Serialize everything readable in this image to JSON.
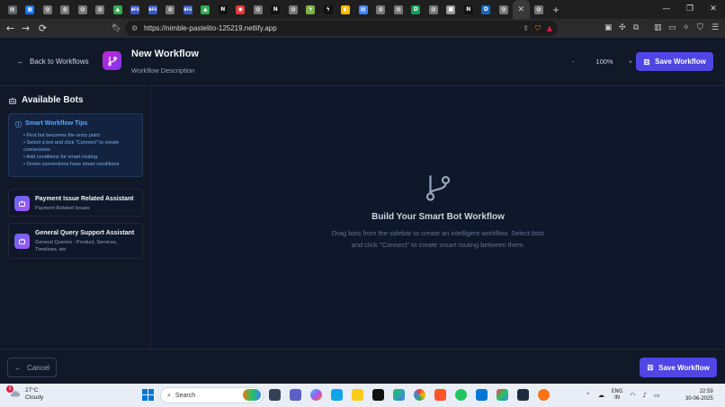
{
  "browser": {
    "tabs": [
      {
        "icon": "doc-icon",
        "color": "#5f6368",
        "glyph": "▤"
      },
      {
        "icon": "app-icon",
        "color": "#1a73e8",
        "glyph": "▦"
      },
      {
        "icon": "globe-icon",
        "color": "#777",
        "glyph": "◍"
      },
      {
        "icon": "globe-icon",
        "color": "#777",
        "glyph": "◍"
      },
      {
        "icon": "globe-icon",
        "color": "#777",
        "glyph": "◍"
      },
      {
        "icon": "globe-icon",
        "color": "#777",
        "glyph": "◍"
      },
      {
        "icon": "drive-icon",
        "color": "#34a853",
        "glyph": "▲"
      },
      {
        "icon": "text-icon",
        "color": "#3a57c4",
        "glyph": "BFS"
      },
      {
        "icon": "text-icon",
        "color": "#3a57c4",
        "glyph": "BFS"
      },
      {
        "icon": "globe-icon",
        "color": "#777",
        "glyph": "◍"
      },
      {
        "icon": "text-icon",
        "color": "#3a57c4",
        "glyph": "BFS"
      },
      {
        "icon": "drive-icon",
        "color": "#34a853",
        "glyph": "▲"
      },
      {
        "icon": "notion-icon",
        "color": "#111",
        "glyph": "N"
      },
      {
        "icon": "video-icon",
        "color": "#e53935",
        "glyph": "◉"
      },
      {
        "icon": "globe-icon",
        "color": "#777",
        "glyph": "◍"
      },
      {
        "icon": "notion-icon",
        "color": "#111",
        "glyph": "N"
      },
      {
        "icon": "globe-icon",
        "color": "#777",
        "glyph": "◍"
      },
      {
        "icon": "bolt-icon",
        "color": "#7cb342",
        "glyph": "ϟ"
      },
      {
        "icon": "bolt-icon",
        "color": "#111",
        "glyph": "ϟ"
      },
      {
        "icon": "chrome-icon",
        "color": "#fbbc04",
        "glyph": "◐"
      },
      {
        "icon": "docs-icon",
        "color": "#4285f4",
        "glyph": "▤"
      },
      {
        "icon": "globe-icon",
        "color": "#777",
        "glyph": "◍"
      },
      {
        "icon": "globe-icon",
        "color": "#777",
        "glyph": "◍"
      },
      {
        "icon": "d-icon",
        "color": "#0f9d58",
        "glyph": "D"
      },
      {
        "icon": "globe-icon",
        "color": "#777",
        "glyph": "◍"
      },
      {
        "icon": "square-icon",
        "color": "#999",
        "glyph": "■"
      },
      {
        "icon": "notion-icon",
        "color": "#111",
        "glyph": "N"
      },
      {
        "icon": "d-icon",
        "color": "#1565c0",
        "glyph": "D"
      },
      {
        "icon": "globe-icon",
        "color": "#777",
        "glyph": "◍"
      },
      {
        "icon": "close-icon",
        "color": "transparent",
        "glyph": "✕"
      },
      {
        "icon": "globe-icon",
        "color": "#777",
        "glyph": "◍"
      }
    ],
    "new_tab": "+",
    "window_controls": [
      "—",
      "❐",
      "✕"
    ],
    "url": "https://nimble-pastelito-125219.netlify.app"
  },
  "header": {
    "back_label": "Back to Workflows",
    "title": "New Workflow",
    "description": "Workflow Description",
    "zoom_minus": "-",
    "zoom_level": "100%",
    "zoom_plus": "+",
    "save_label": "Save Workflow"
  },
  "sidebar": {
    "title": "Available Bots",
    "tips_title": "Smart Workflow Tips",
    "tips": [
      "• First bot becomes the entry point",
      "• Select a bot and click \"Connect\" to create connections",
      "• Add conditions for smart routing",
      "• Green connections have smart conditions"
    ],
    "bots": [
      {
        "name": "Payment Issue Related Assistant",
        "desc": "Payment Related Issues"
      },
      {
        "name": "General Query Support Assistant",
        "desc": "General Queries - Product, Services, Timelines, etc"
      }
    ]
  },
  "canvas": {
    "empty_title": "Build Your Smart Bot Workflow",
    "empty_body": "Drag bots from the sidebar to create an intelligent workflow. Select bots and click \"Connect\" to create smart routing between them."
  },
  "footer": {
    "cancel_label": "Cancel",
    "save_label": "Save Workflow"
  },
  "taskbar": {
    "weather_temp": "27°C",
    "weather_desc": "Cloudy",
    "weather_badge": "3",
    "search_label": "Search",
    "lang_line1": "ENG",
    "lang_line2": "IN",
    "time": "22:59",
    "date": "30-06-2025"
  },
  "colors": {
    "accent": "#4f46e5",
    "logo_gradient_start": "#c026d3",
    "logo_gradient_end": "#7c3aed",
    "tip_text": "#60a5fa"
  }
}
